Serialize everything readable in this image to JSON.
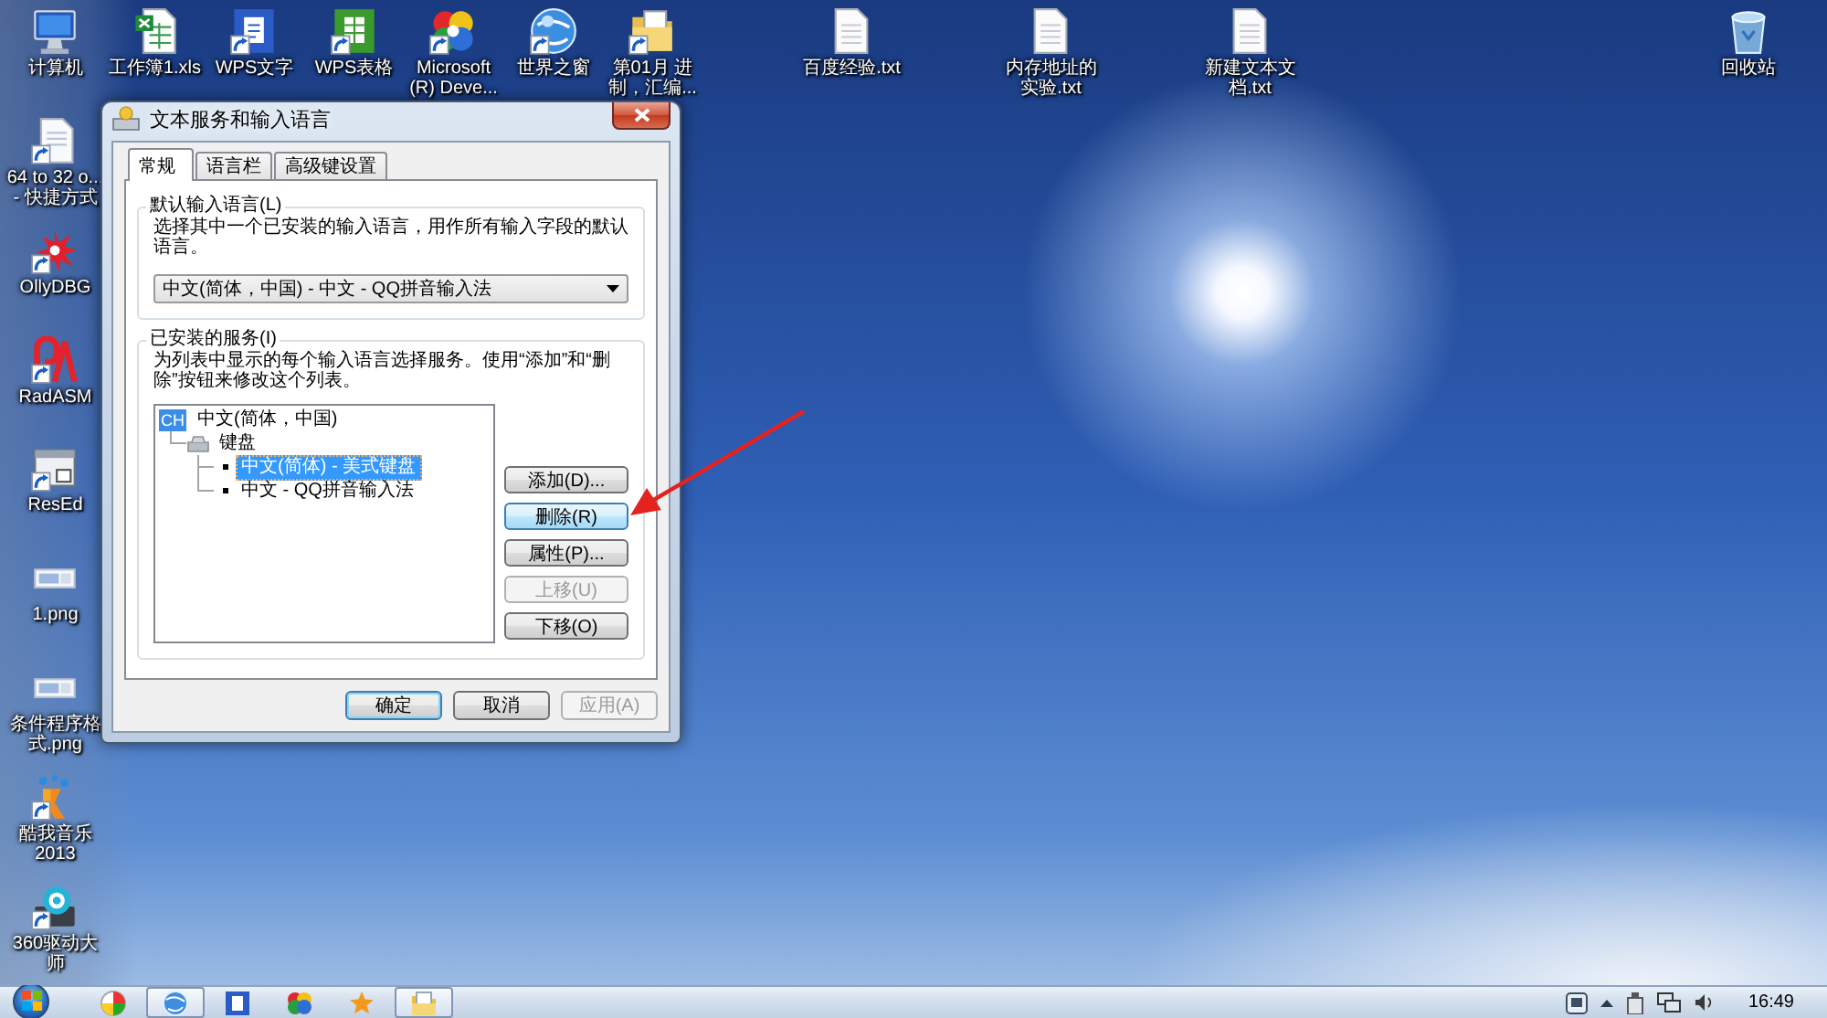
{
  "desktop": {
    "top_row": [
      {
        "label": "计算机",
        "kind": "computer",
        "shortcut": false
      },
      {
        "label": "工作簿1.xls",
        "kind": "spreadsheet",
        "shortcut": false
      },
      {
        "label": "WPS文字",
        "kind": "wps-writer",
        "shortcut": true
      },
      {
        "label": "WPS表格",
        "kind": "wps-sheet",
        "shortcut": true
      },
      {
        "label": "Microsoft (R) Deve...",
        "kind": "colorful",
        "shortcut": true
      },
      {
        "label": "世界之窗",
        "kind": "globe",
        "shortcut": true
      },
      {
        "label": "第01月 进制，汇编...",
        "kind": "folder",
        "shortcut": true
      },
      {
        "label": "百度经验.txt",
        "kind": "text-file",
        "shortcut": false
      },
      {
        "label": "内存地址的实验.txt",
        "kind": "text-file",
        "shortcut": false
      },
      {
        "label": "新建文本文档.txt",
        "kind": "text-file",
        "shortcut": false
      },
      {
        "label": "回收站",
        "kind": "recycle-bin",
        "shortcut": false
      }
    ],
    "left_column": [
      {
        "label": "64 to 32 o... - 快捷方式",
        "kind": "document",
        "shortcut": true
      },
      {
        "label": "OllyDBG",
        "kind": "bug",
        "shortcut": true
      },
      {
        "label": "RadASM",
        "kind": "letters",
        "shortcut": true
      },
      {
        "label": "ResEd",
        "kind": "window",
        "shortcut": true
      },
      {
        "label": "1.png",
        "kind": "image",
        "shortcut": false
      },
      {
        "label": "条件程序格式.png",
        "kind": "image",
        "shortcut": false
      },
      {
        "label": "酷我音乐 2013",
        "kind": "music",
        "shortcut": true
      },
      {
        "label": "360驱动大师",
        "kind": "gear",
        "shortcut": true
      }
    ]
  },
  "window": {
    "title": "文本服务和输入语言",
    "tabs": [
      {
        "label": "常规",
        "selected": true
      },
      {
        "label": "语言栏",
        "selected": false
      },
      {
        "label": "高级键设置",
        "selected": false
      }
    ],
    "default_language": {
      "title": "默认输入语言(L)",
      "description": "选择其中一个已安装的输入语言，用作所有输入字段的默认语言。",
      "dropdown": {
        "value": "中文(简体，中国) - 中文 - QQ拼音输入法"
      }
    },
    "installed_services": {
      "title": "已安装的服务(I)",
      "description": "为列表中显示的每个输入语言选择服务。使用“添加”和“删除”按钮来修改这个列表。",
      "tree": [
        {
          "badge": "CH",
          "label": "中文(简体，中国)",
          "selected": false,
          "children": [
            {
              "label": "键盘",
              "selected": false,
              "children": [
                {
                  "label": "中文(简体) - 美式键盘",
                  "selected": true
                },
                {
                  "label": "中文 - QQ拼音输入法",
                  "selected": false
                }
              ]
            }
          ]
        }
      ],
      "buttons": [
        {
          "label": "添加(D)...",
          "disabled": false,
          "hovered": false
        },
        {
          "label": "删除(R)",
          "disabled": false,
          "hovered": true
        },
        {
          "label": "属性(P)...",
          "disabled": false,
          "hovered": false
        },
        {
          "label": "上移(U)",
          "disabled": true,
          "hovered": false
        },
        {
          "label": "下移(O)",
          "disabled": false,
          "hovered": false
        }
      ]
    },
    "footer_buttons": [
      {
        "label": "确定",
        "default": true,
        "disabled": false
      },
      {
        "label": "取消",
        "default": false,
        "disabled": false
      },
      {
        "label": "应用(A)",
        "default": false,
        "disabled": true
      }
    ]
  },
  "taskbar": {
    "items": [
      {
        "kind": "media",
        "active": false
      },
      {
        "kind": "browser",
        "active": true
      },
      {
        "kind": "writer",
        "active": false
      },
      {
        "kind": "colorful",
        "active": false
      },
      {
        "kind": "star",
        "active": false
      },
      {
        "kind": "explorer",
        "active": true
      }
    ],
    "clock": "16:49"
  }
}
